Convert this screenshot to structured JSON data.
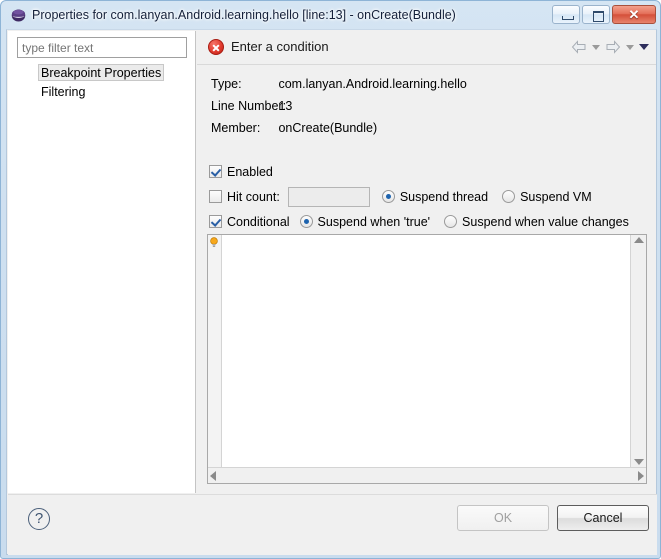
{
  "window": {
    "title": "Properties for com.lanyan.Android.learning.hello [line:13] - onCreate(Bundle)",
    "icon": "eclipse-icon",
    "controls": {
      "minimize": "minimize-button",
      "maximize": "maximize-button",
      "close_glyph": "✕"
    }
  },
  "sidebar": {
    "filter": {
      "placeholder": "type filter text",
      "value": ""
    },
    "items": [
      {
        "label": "Breakpoint Properties",
        "selected": true
      },
      {
        "label": "Filtering",
        "selected": false
      }
    ]
  },
  "page": {
    "header": {
      "status_icon": "error-icon",
      "title": "Enter a condition"
    },
    "nav": {
      "back": "back-arrow",
      "back_menu": "back-dropdown",
      "forward": "forward-arrow",
      "forward_menu": "forward-dropdown",
      "menu": "view-menu"
    },
    "info": [
      {
        "label": "Type:",
        "value": "com.lanyan.Android.learning.hello"
      },
      {
        "label": "Line Number:",
        "value": "13"
      },
      {
        "label": "Member:",
        "value": "onCreate(Bundle)"
      }
    ],
    "options": {
      "enabled": {
        "label": "Enabled",
        "checked": true
      },
      "hit_count": {
        "label": "Hit count:",
        "checked": false,
        "value": ""
      },
      "suspend_thread": {
        "label": "Suspend thread",
        "selected": true
      },
      "suspend_vm": {
        "label": "Suspend VM",
        "selected": false
      },
      "conditional": {
        "label": "Conditional",
        "checked": true
      },
      "suspend_when_true": {
        "label": "Suspend when 'true'",
        "selected": true
      },
      "suspend_when_value_changes": {
        "label": "Suspend when value changes",
        "selected": false
      }
    },
    "editor": {
      "value": "",
      "hint_icon": "lightbulb-icon"
    }
  },
  "footer": {
    "help_label": "?",
    "ok_label": "OK",
    "cancel_label": "Cancel"
  },
  "colors": {
    "accent": "#1e63ae",
    "error": "#e23b2e",
    "hint": "#f5a623",
    "frame": "#8eb4d6"
  }
}
